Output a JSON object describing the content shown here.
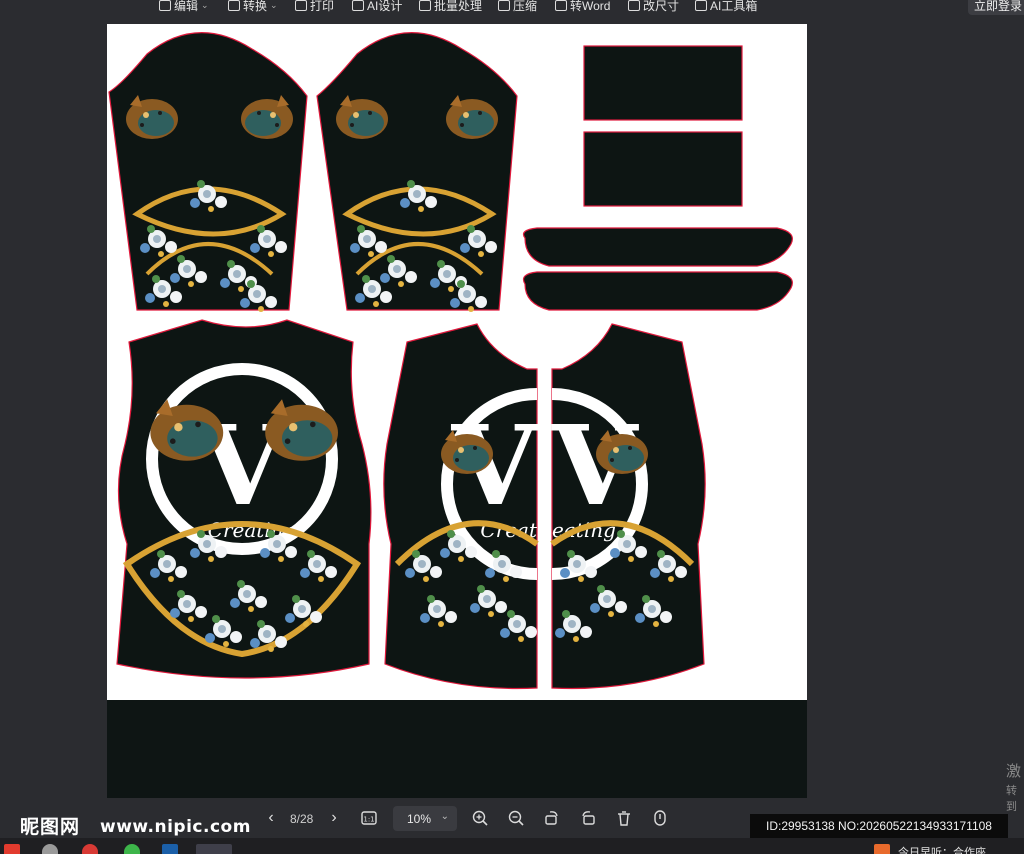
{
  "toolbar": {
    "items": [
      {
        "label": "编辑",
        "icon": "edit-icon"
      },
      {
        "label": "转换",
        "icon": "convert-icon"
      },
      {
        "label": "打印",
        "icon": "print-icon"
      },
      {
        "label": "AI设计",
        "icon": "ai-design-icon"
      },
      {
        "label": "批量处理",
        "icon": "batch-icon"
      },
      {
        "label": "压缩",
        "icon": "compress-icon"
      },
      {
        "label": "转Word",
        "icon": "word-icon"
      },
      {
        "label": "改尺寸",
        "icon": "resize-icon"
      },
      {
        "label": "AI工具箱",
        "icon": "ai-toolbox-icon"
      }
    ],
    "login_label": "立即登录"
  },
  "artwork": {
    "center_letter": "V",
    "script_text": "Creating",
    "colors": {
      "panel": "#0d1513",
      "outline": "#e0193c",
      "gold": "#d8a233",
      "flower": "#eef2f4"
    }
  },
  "bottombar": {
    "brand": "昵图网",
    "brand_url": "www.nipic.com",
    "page_indicator": "8/28",
    "zoom": "10%",
    "watermark_id": "ID:29953138 NO:20260522134933171108"
  },
  "side": {
    "text1": "激",
    "text2": "转到"
  },
  "taskbar": {
    "text": "今日早听：合作座"
  }
}
